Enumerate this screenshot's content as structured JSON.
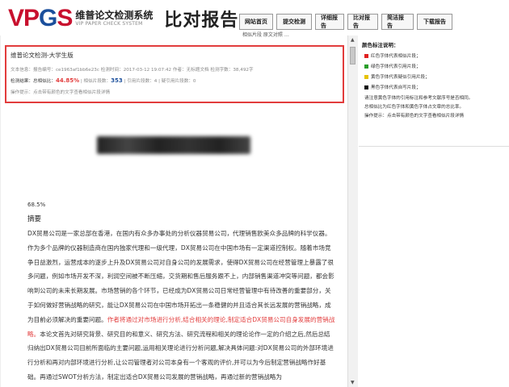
{
  "header": {
    "logo_v": "V",
    "logo_p": "P",
    "logo_g": "G",
    "logo_s": "S",
    "logo_cn": "维普论文检测系统",
    "logo_en": "VIP PAPER CHECK SYSTEM",
    "title": "比对报告",
    "nav": [
      "网站首页",
      "提交检测",
      "详细报告",
      "比对报告",
      "简洁报告",
      "下载报告"
    ],
    "nav_overflow": "相似片段    原文对照    …"
  },
  "info": {
    "title": "维普论文检测-大学生版",
    "line1": "文本信息：报告编号：ce1963af1bb6e23c   检测时间：2017-03-12 19:07:42   作者：无标题文档   检测字数：38,492字",
    "line2_label": "检测结果：总相似比：",
    "similarity": "44.85%",
    "line2_mid": "  |  相似片段数：",
    "similar_count": "353",
    "line2_tail": "  |  引用片段数：4  |  疑引用片段数：0",
    "line3": "操作提示：点击带有颜色的文字查看相似片段详情"
  },
  "document": {
    "score": "68.5%",
    "abstract_heading": "摘要",
    "para_normal_1": "DX贸易公司是一家总部在香港，在国内有众多办事处的分析仪器贸易公司，代理销售欧美众多品牌的科学仪器。作为多个品牌的仪器制造商在国内独家代理和一级代理，DX贸易公司在中国市场有一定渠道控制权。随着市场竞争日益激烈，运营成本的逐步上升及DX贸易公司对自身公司的发展需求，使得DX贸易公司在经营管理上暴露了很多问题，例如市场开发不深，利润空间被不断压缩，交货期和售后服务跟不上，内部销售渠道冲突等问题，都会影响到公司的未来长期发展。市场营销的各个环节，已经成为DX贸易公司日常经营管理中有待改善的重要部分，关于如何做好营销战略的研究，能让DX贸易公司在中国市场开拓出一条稳健的并且适合其长远发展的营销战略，成为目前必须解决的重要问题。",
    "para_red": "作者将通过对市场进行分析,结合相关的理论,制定适合DX贸易公司自身发展的营销战略。",
    "para_normal_2": "本论文首先对研究背景、研究目的和意义、研究方法、研究流程和相关的理论论作一定的介绍之后,然后总结归纳出DX贸易公司目前所面临的主要问题,运用相关理论进行分析问题,解决具体问题:对DX贸易公司的外部环境进行分析和再对内部环境进行分析,让公司管理者对公司本身有一个客观的评价,并可以为今后制定营销战略作好基础。再通过SWOT分析方法，制定出适合DX贸易公司发展的营销战略，再通过新的营销战略为"
  },
  "sidebar": {
    "heading": "颜色标注说明：",
    "legend": [
      {
        "label": "红色字体代表相似片段；",
        "color": "#e02020"
      },
      {
        "label": "绿色字体代表引用片段；",
        "color": "#2a9d2a"
      },
      {
        "label": "黄色字体代表疑似引用片段；",
        "color": "#e6c200"
      },
      {
        "label": "黑色字体代表自写片段；",
        "color": "#111111"
      }
    ],
    "note1": "请注意黄色字体的引用标注和参考文献序号是否相同。",
    "note2": "总相似比为红色字体和黄色字体占文章的总比率。",
    "note3": "操作提示：点击带有颜色的文字查看相似片段详情"
  }
}
